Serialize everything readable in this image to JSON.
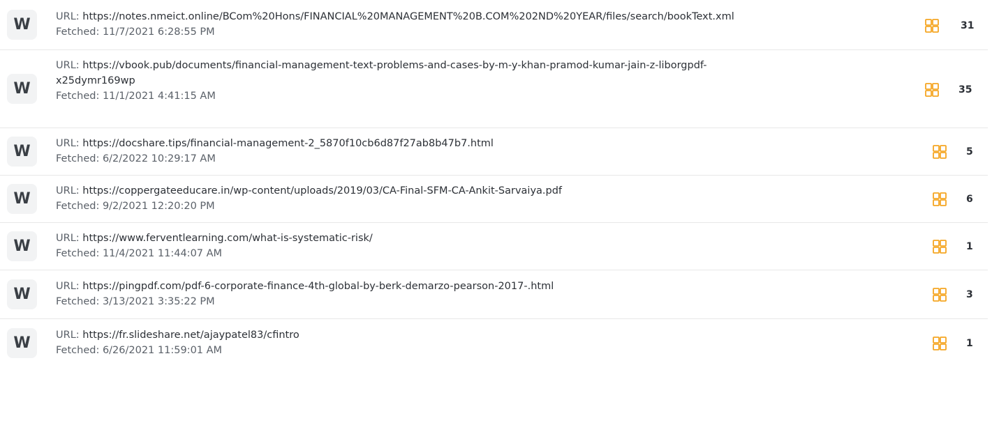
{
  "sources": [
    {
      "logo_letter": "W",
      "url_label": "URL:",
      "url": "https://notes.nmeict.online/BCom%20Hons/FINANCIAL%20MANAGEMENT%20B.COM%202ND%20YEAR/files/search/bookText.xml",
      "fetched_label": "Fetched:",
      "fetched": "11/7/2021 6:28:55 PM",
      "match_count": "31"
    },
    {
      "logo_letter": "W",
      "url_label": "URL:",
      "url_line1": "https://vbook.pub/documents/financial-management-text-problems-and-cases-by-m-y-khan-pramod-kumar-jain-z-liborgpdf-",
      "url_line2": "x25dymr169wp",
      "fetched_label": "Fetched:",
      "fetched": "11/1/2021 4:41:15 AM",
      "match_count": "35"
    },
    {
      "logo_letter": "W",
      "url_label": "URL:",
      "url": "https://docshare.tips/financial-management-2_5870f10cb6d87f27ab8b47b7.html",
      "fetched_label": "Fetched:",
      "fetched": "6/2/2022 10:29:17 AM",
      "match_count": "5"
    },
    {
      "logo_letter": "W",
      "url_label": "URL:",
      "url": "https://coppergateeducare.in/wp-content/uploads/2019/03/CA-Final-SFM-CA-Ankit-Sarvaiya.pdf",
      "fetched_label": "Fetched:",
      "fetched": "9/2/2021 12:20:20 PM",
      "match_count": "6"
    },
    {
      "logo_letter": "W",
      "url_label": "URL:",
      "url": "https://www.ferventlearning.com/what-is-systematic-risk/",
      "fetched_label": "Fetched:",
      "fetched": "11/4/2021 11:44:07 AM",
      "match_count": "1"
    },
    {
      "logo_letter": "W",
      "url_label": "URL:",
      "url": "https://pingpdf.com/pdf-6-corporate-finance-4th-global-by-berk-demarzo-pearson-2017-.html",
      "fetched_label": "Fetched:",
      "fetched": "3/13/2021 3:35:22 PM",
      "match_count": "3"
    },
    {
      "logo_letter": "W",
      "url_label": "URL:",
      "url": "https://fr.slideshare.net/ajaypatel83/cfintro",
      "fetched_label": "Fetched:",
      "fetched": "6/26/2021 11:59:01 AM",
      "match_count": "1"
    }
  ],
  "colors": {
    "grid_icon": "#f5a623",
    "text": "#5a6068",
    "url": "#2c3036",
    "logo_bg": "#f2f3f4"
  },
  "icons": {
    "logo": "web-source-logo",
    "matches": "grid-icon"
  }
}
